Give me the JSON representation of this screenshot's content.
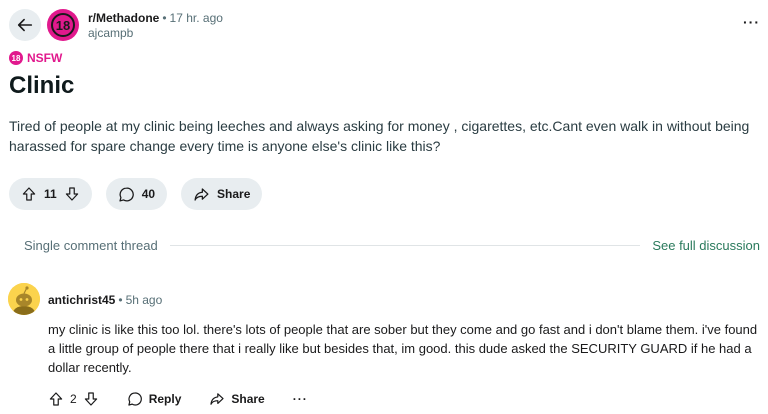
{
  "post": {
    "subreddit": "r/Methadone",
    "time": "17 hr. ago",
    "author": "ajcampb",
    "avatar_text": "18",
    "nsfw_badge": "18",
    "nsfw_label": "NSFW",
    "title": "Clinic",
    "body": "Tired of people at my clinic being leeches and always asking for money , cigarettes, etc.Cant even walk in without being harassed for spare change every time is anyone else's clinic like this?",
    "votes": "11",
    "comments": "40",
    "share_label": "Share"
  },
  "thread": {
    "single_label": "Single comment thread",
    "full_label": "See full discussion"
  },
  "comment": {
    "user": "antichrist45",
    "time": "5h ago",
    "text": "my clinic is like this too lol. there's lots of people that are sober but they come and go fast and i don't blame them. i've found a little group of people there that i really like but besides that, im good. this dude asked the SECURITY GUARD if he had a dollar recently.",
    "votes": "2",
    "reply_label": "Reply",
    "share_label": "Share"
  },
  "colors": {
    "accent": "#e1198d",
    "link": "#2a7a5c",
    "pill_bg": "#e8edf0"
  }
}
